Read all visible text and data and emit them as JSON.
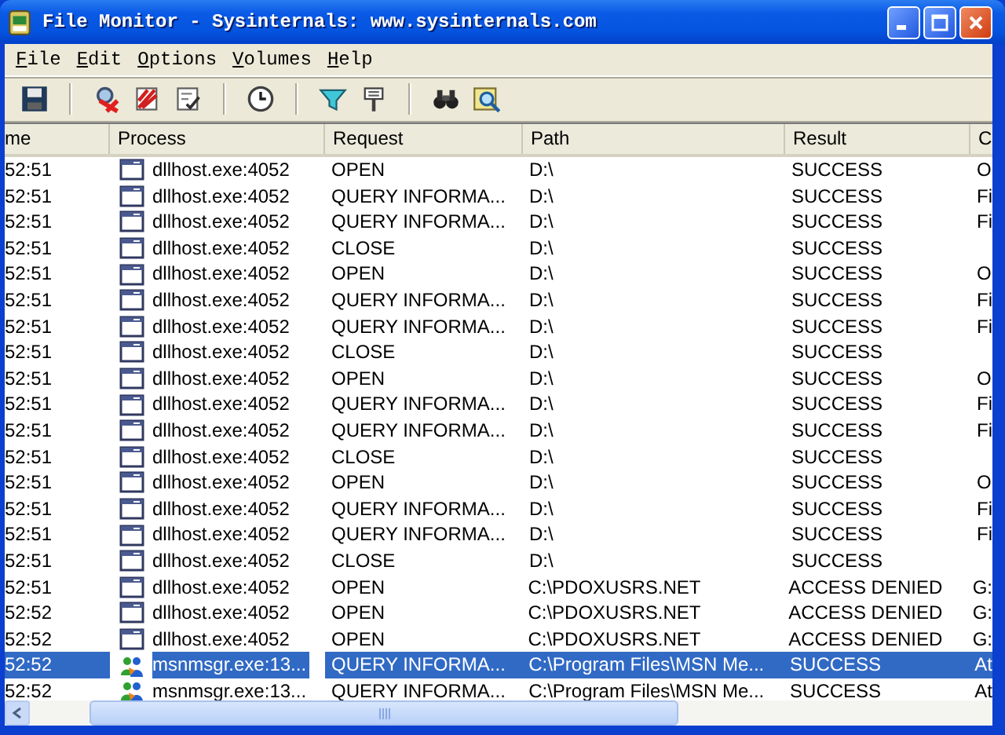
{
  "window": {
    "title": "File Monitor - Sysinternals: www.sysinternals.com"
  },
  "menu": [
    "File",
    "Edit",
    "Options",
    "Volumes",
    "Help"
  ],
  "table": {
    "columns": [
      "me",
      "Process",
      "Request",
      "Path",
      "Result",
      "C"
    ],
    "rows": [
      {
        "time": "52:51",
        "process": "dllhost.exe:4052",
        "kind": "window",
        "request": "OPEN",
        "path": "D:\\",
        "result": "SUCCESS",
        "column_6": "O",
        "selected": false
      },
      {
        "time": "52:51",
        "process": "dllhost.exe:4052",
        "kind": "window",
        "request": "QUERY INFORMA...",
        "path": "D:\\",
        "result": "SUCCESS",
        "column_6": "Fi",
        "selected": false
      },
      {
        "time": "52:51",
        "process": "dllhost.exe:4052",
        "kind": "window",
        "request": "QUERY INFORMA...",
        "path": "D:\\",
        "result": "SUCCESS",
        "column_6": "Fi",
        "selected": false
      },
      {
        "time": "52:51",
        "process": "dllhost.exe:4052",
        "kind": "window",
        "request": "CLOSE",
        "path": "D:\\",
        "result": "SUCCESS",
        "selected": false
      },
      {
        "time": "52:51",
        "process": "dllhost.exe:4052",
        "kind": "window",
        "request": "OPEN",
        "path": "D:\\",
        "result": "SUCCESS",
        "column_6": "O",
        "selected": false
      },
      {
        "time": "52:51",
        "process": "dllhost.exe:4052",
        "kind": "window",
        "request": "QUERY INFORMA...",
        "path": "D:\\",
        "result": "SUCCESS",
        "column_6": "Fi",
        "selected": false
      },
      {
        "time": "52:51",
        "process": "dllhost.exe:4052",
        "kind": "window",
        "request": "QUERY INFORMA...",
        "path": "D:\\",
        "result": "SUCCESS",
        "column_6": "Fi",
        "selected": false
      },
      {
        "time": "52:51",
        "process": "dllhost.exe:4052",
        "kind": "window",
        "request": "CLOSE",
        "path": "D:\\",
        "result": "SUCCESS",
        "selected": false
      },
      {
        "time": "52:51",
        "process": "dllhost.exe:4052",
        "kind": "window",
        "request": "OPEN",
        "path": "D:\\",
        "result": "SUCCESS",
        "column_6": "O",
        "selected": false
      },
      {
        "time": "52:51",
        "process": "dllhost.exe:4052",
        "kind": "window",
        "request": "QUERY INFORMA...",
        "path": "D:\\",
        "result": "SUCCESS",
        "column_6": "Fi",
        "selected": false
      },
      {
        "time": "52:51",
        "process": "dllhost.exe:4052",
        "kind": "window",
        "request": "QUERY INFORMA...",
        "path": "D:\\",
        "result": "SUCCESS",
        "column_6": "Fi",
        "selected": false
      },
      {
        "time": "52:51",
        "process": "dllhost.exe:4052",
        "kind": "window",
        "request": "CLOSE",
        "path": "D:\\",
        "result": "SUCCESS",
        "selected": false
      },
      {
        "time": "52:51",
        "process": "dllhost.exe:4052",
        "kind": "window",
        "request": "OPEN",
        "path": "D:\\",
        "result": "SUCCESS",
        "column_6": "O",
        "selected": false
      },
      {
        "time": "52:51",
        "process": "dllhost.exe:4052",
        "kind": "window",
        "request": "QUERY INFORMA...",
        "path": "D:\\",
        "result": "SUCCESS",
        "column_6": "Fi",
        "selected": false
      },
      {
        "time": "52:51",
        "process": "dllhost.exe:4052",
        "kind": "window",
        "request": "QUERY INFORMA...",
        "path": "D:\\",
        "result": "SUCCESS",
        "column_6": "Fi",
        "selected": false
      },
      {
        "time": "52:51",
        "process": "dllhost.exe:4052",
        "kind": "window",
        "request": "CLOSE",
        "path": "D:\\",
        "result": "SUCCESS",
        "selected": false
      },
      {
        "time": "52:51",
        "process": "dllhost.exe:4052",
        "kind": "window",
        "request": "OPEN",
        "path": "C:\\PDOXUSRS.NET",
        "result": "ACCESS DENIED",
        "column_6": "G:",
        "selected": false
      },
      {
        "time": "52:52",
        "process": "dllhost.exe:4052",
        "kind": "window",
        "request": "OPEN",
        "path": "C:\\PDOXUSRS.NET",
        "result": "ACCESS DENIED",
        "column_6": "G:",
        "selected": false
      },
      {
        "time": "52:52",
        "process": "dllhost.exe:4052",
        "kind": "window",
        "request": "OPEN",
        "path": "C:\\PDOXUSRS.NET",
        "result": "ACCESS DENIED",
        "column_6": "G:",
        "selected": false
      },
      {
        "time": "52:52",
        "process": "msnmsgr.exe:13...",
        "kind": "people",
        "request": "QUERY INFORMA...",
        "path": "C:\\Program Files\\MSN Me...",
        "result": "SUCCESS",
        "column_6": "At",
        "selected": true
      },
      {
        "time": "52:52",
        "process": "msnmsgr.exe:13...",
        "kind": "people",
        "request": "QUERY INFORMA...",
        "path": "C:\\Program Files\\MSN Me...",
        "result": "SUCCESS",
        "column_6": "At",
        "selected": false
      }
    ]
  }
}
